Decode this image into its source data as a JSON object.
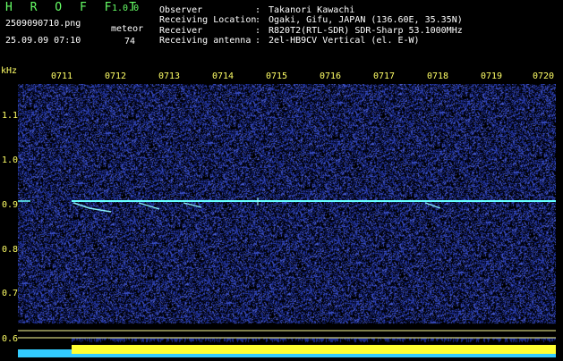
{
  "app": {
    "title": "H R O F F T",
    "version": "1.0.0"
  },
  "file": {
    "name": "2509090710.png",
    "datetime": "25.09.09 07:10"
  },
  "meteor": {
    "label": "meteor",
    "count": "74"
  },
  "info": [
    {
      "key": "Observer",
      "value": "Takanori Kawachi"
    },
    {
      "key": "Receiving Location",
      "value": "Ogaki, Gifu, JAPAN (136.60E, 35.35N)"
    },
    {
      "key": "Receiver",
      "value": "R820T2(RTL-SDR) SDR-Sharp 53.1000MHz"
    },
    {
      "key": "Receiving antenna",
      "value": "2el-HB9CV Vertical (el. E-W)"
    }
  ],
  "axis": {
    "y_unit": "kHz",
    "x_ticks": [
      "0711",
      "0712",
      "0713",
      "0714",
      "0715",
      "0716",
      "0717",
      "0718",
      "0719",
      "0720"
    ],
    "y_ticks": [
      "1.1",
      "1.0",
      "0.9",
      "0.8",
      "0.7",
      "0.6"
    ]
  },
  "colors": {
    "background": "#000000",
    "noise": "#1a2a8a",
    "carrier": "#66ffff",
    "level_bar": "#ffff33",
    "level_base": "#33ccff",
    "gridline": "#ffff99"
  }
}
